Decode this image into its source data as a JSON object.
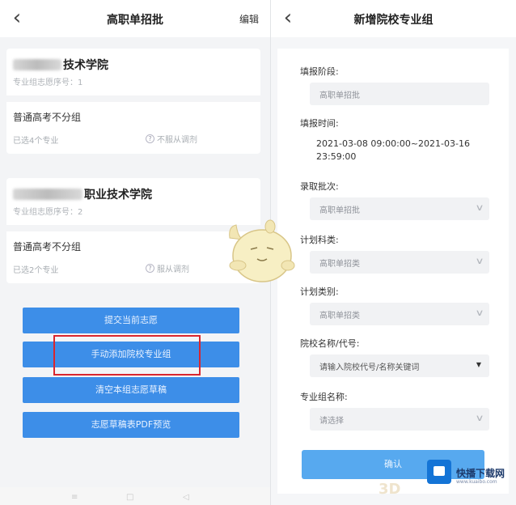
{
  "left_screen": {
    "title": "高职单招批",
    "edit": "编辑",
    "back_icon": "chevron-left",
    "cards": [
      {
        "school_name": "技术学院",
        "order": "专业组志愿序号：1",
        "group_type": "普通高考不分组",
        "selected": "已选4个专业",
        "adjust": "不服从调剂"
      },
      {
        "school_name": "职业技术学院",
        "order": "专业组志愿序号：2",
        "group_type": "普通高考不分组",
        "selected": "已选2个专业",
        "adjust": "服从调剂"
      }
    ],
    "buttons": [
      "提交当前志愿",
      "手动添加院校专业组",
      "清空本组志愿草稿",
      "志愿草稿表PDF预览"
    ],
    "bottom_nav": [
      "≡",
      "□",
      "◁"
    ]
  },
  "right_screen": {
    "title": "新增院校专业组",
    "back_icon": "chevron-left",
    "fields": {
      "stage_label": "填报阶段:",
      "stage_value": "高职单招批",
      "time_label": "填报时间:",
      "time_line1": "2021-03-08 09:00:00~2021-03-16",
      "time_line2": "23:59:00",
      "batch_label": "录取批次:",
      "batch_value": "高职单招批",
      "subject_label": "计划科类:",
      "subject_value": "高职单招类",
      "category_label": "计划类别:",
      "category_value": "高职单招类",
      "school_label": "院校名称/代号:",
      "school_placeholder": "请输入院校代号/名称关键词",
      "group_label": "专业组名称:",
      "group_placeholder": "请选择"
    },
    "submit": "确认"
  },
  "watermark": {
    "brand": "快播下载网",
    "domain": "www.kuaibo.com",
    "mark": "3D"
  },
  "colors": {
    "button_blue": "#3d8ee8",
    "submit_blue": "#57a9ef",
    "highlight_red": "#d9262e"
  }
}
